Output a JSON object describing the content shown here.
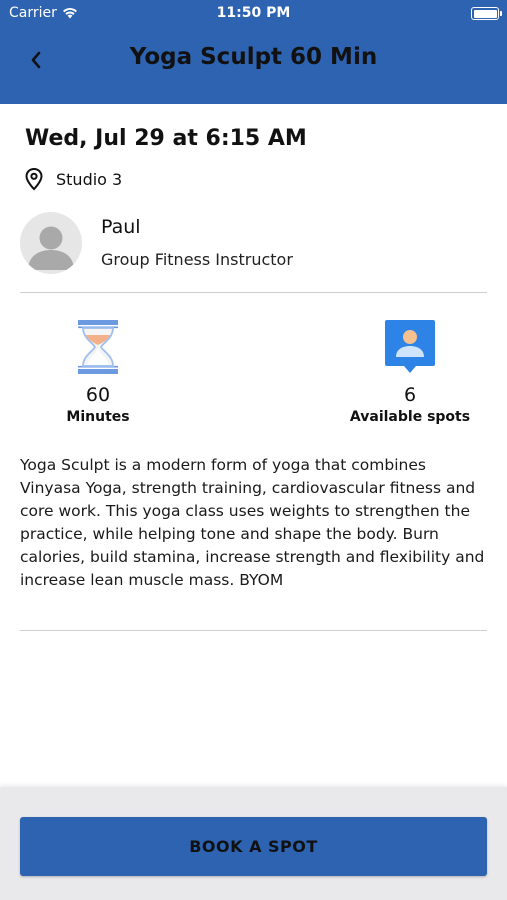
{
  "status_bar": {
    "carrier": "Carrier",
    "time": "11:50 PM"
  },
  "header": {
    "title": "Yoga Sculpt 60 Min",
    "back_icon": "chevron-left-icon",
    "background_color": "#2d63b1"
  },
  "session": {
    "datetime": "Wed, Jul 29 at 6:15 AM",
    "location": "Studio 3"
  },
  "instructor": {
    "name": "Paul",
    "role": "Group Fitness Instructor"
  },
  "stats": {
    "duration": {
      "value": "60",
      "label": "Minutes",
      "icon": "hourglass-icon"
    },
    "spots": {
      "value": "6",
      "label": "Available spots",
      "icon": "person-badge-icon"
    }
  },
  "description": "Yoga Sculpt is a modern form of yoga that combines Vinyasa Yoga, strength training, cardiovascular fitness and core work. This yoga class uses weights to strengthen the practice, while helping tone and shape the body. Burn calories, build stamina, increase strength and flexibility and increase lean muscle mass. BYOM",
  "footer": {
    "book_label": "BOOK A SPOT",
    "accent_color": "#2d63b1"
  }
}
